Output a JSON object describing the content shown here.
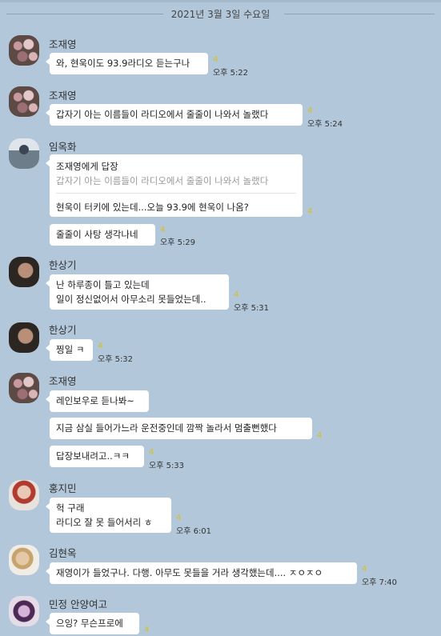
{
  "date_divider": "2021년 3월 3일 수요일",
  "messages": [
    {
      "sender": "조재영",
      "text": "와, 현욱이도 93.9라디오 듣는구나",
      "unread": "4",
      "time": "오후 5:22"
    },
    {
      "sender": "조재영",
      "text": "갑자기 아는 이름들이 라디오에서 줄줄이 나와서 놀랬다",
      "unread": "4",
      "time": "오후 5:24"
    },
    {
      "sender": "임옥화",
      "reply_head": "조재영에게 답장",
      "reply_quote": "갑자기 아는 이름들이 라디오에서 줄줄이 나와서 놀랬다",
      "reply_text": "현욱이 터키에 있는데...오늘 93.9에 현욱이 나옴?",
      "reply_unread": "4",
      "text": "줄줄이 사탕 생각나네",
      "unread": "4",
      "time": "오후 5:29"
    },
    {
      "sender": "한상기",
      "line1": "난 하루종이 틀고 있는데",
      "line2": "일이 정신없어서 아무소리 못들었는데..",
      "unread": "4",
      "time": "오후 5:31"
    },
    {
      "sender": "한상기",
      "text": "찡일 ㅋ",
      "unread": "4",
      "time": "오후 5:32"
    },
    {
      "sender": "조재영",
      "text": "레인보우로 듣나봐~",
      "text2": "지금 삼실 들어가느라 운전중인데 깜짝 놀라서 멈출뻔했다",
      "unread2": "4",
      "text3": "답장보내려고..ㅋㅋ",
      "unread3": "4",
      "time3": "오후 5:33"
    },
    {
      "sender": "홍지민",
      "line1": "헉 구래",
      "line2": "라디오 잘 못 들어서리 ㅎ",
      "unread": "4",
      "time": "오후 6:01"
    },
    {
      "sender": "김현옥",
      "text": "재영이가 들었구나. 다행. 아무도 못들을 거라 생각했는데.... ㅈㅇㅈㅇ",
      "unread": "4",
      "time": "오후 7:40"
    },
    {
      "sender": "민정 안양여고",
      "text": "으잉?  무슨프로에",
      "unread": "4"
    }
  ]
}
